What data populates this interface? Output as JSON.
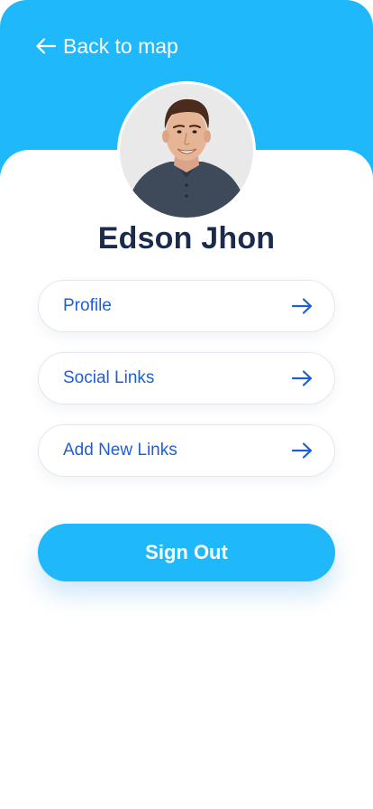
{
  "header": {
    "back_label": "Back to map",
    "back_icon": "arrow-left-icon",
    "background_color": "#1eb8fb"
  },
  "profile": {
    "name": "Edson Jhon",
    "avatar": "profile-photo"
  },
  "menu": {
    "items": [
      {
        "label": "Profile",
        "icon": "arrow-right-icon"
      },
      {
        "label": "Social Links",
        "icon": "arrow-right-icon"
      },
      {
        "label": "Add New Links",
        "icon": "arrow-right-icon"
      }
    ],
    "text_color": "#1f5fd6"
  },
  "actions": {
    "signout_label": "Sign Out",
    "signout_color": "#1eb8fb"
  }
}
